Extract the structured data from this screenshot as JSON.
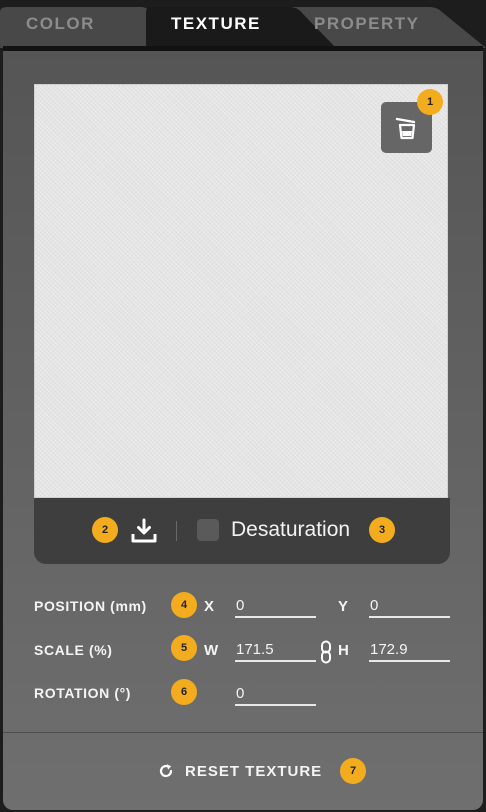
{
  "tabs": [
    {
      "label": "COLOR",
      "active": false
    },
    {
      "label": "TEXTURE",
      "active": true
    },
    {
      "label": "PROPERTY",
      "active": false
    }
  ],
  "badges": [
    "1",
    "2",
    "3",
    "4",
    "5",
    "6",
    "7"
  ],
  "controls": {
    "desaturation_label": "Desaturation",
    "desaturation_checked": false
  },
  "position": {
    "label": "POSITION (mm)",
    "x_label": "X",
    "x_value": "0",
    "y_label": "Y",
    "y_value": "0"
  },
  "scale": {
    "label": "SCALE (%)",
    "w_label": "W",
    "w_value": "171.5",
    "h_label": "H",
    "h_value": "172.9"
  },
  "rotation": {
    "label": "ROTATION (°)",
    "value": "0"
  },
  "reset": {
    "label": "RESET TEXTURE"
  },
  "colors": {
    "accent_badge": "#f4ac1f",
    "panel": "#5e5e5e",
    "tab_active": "#1a1a1a"
  }
}
